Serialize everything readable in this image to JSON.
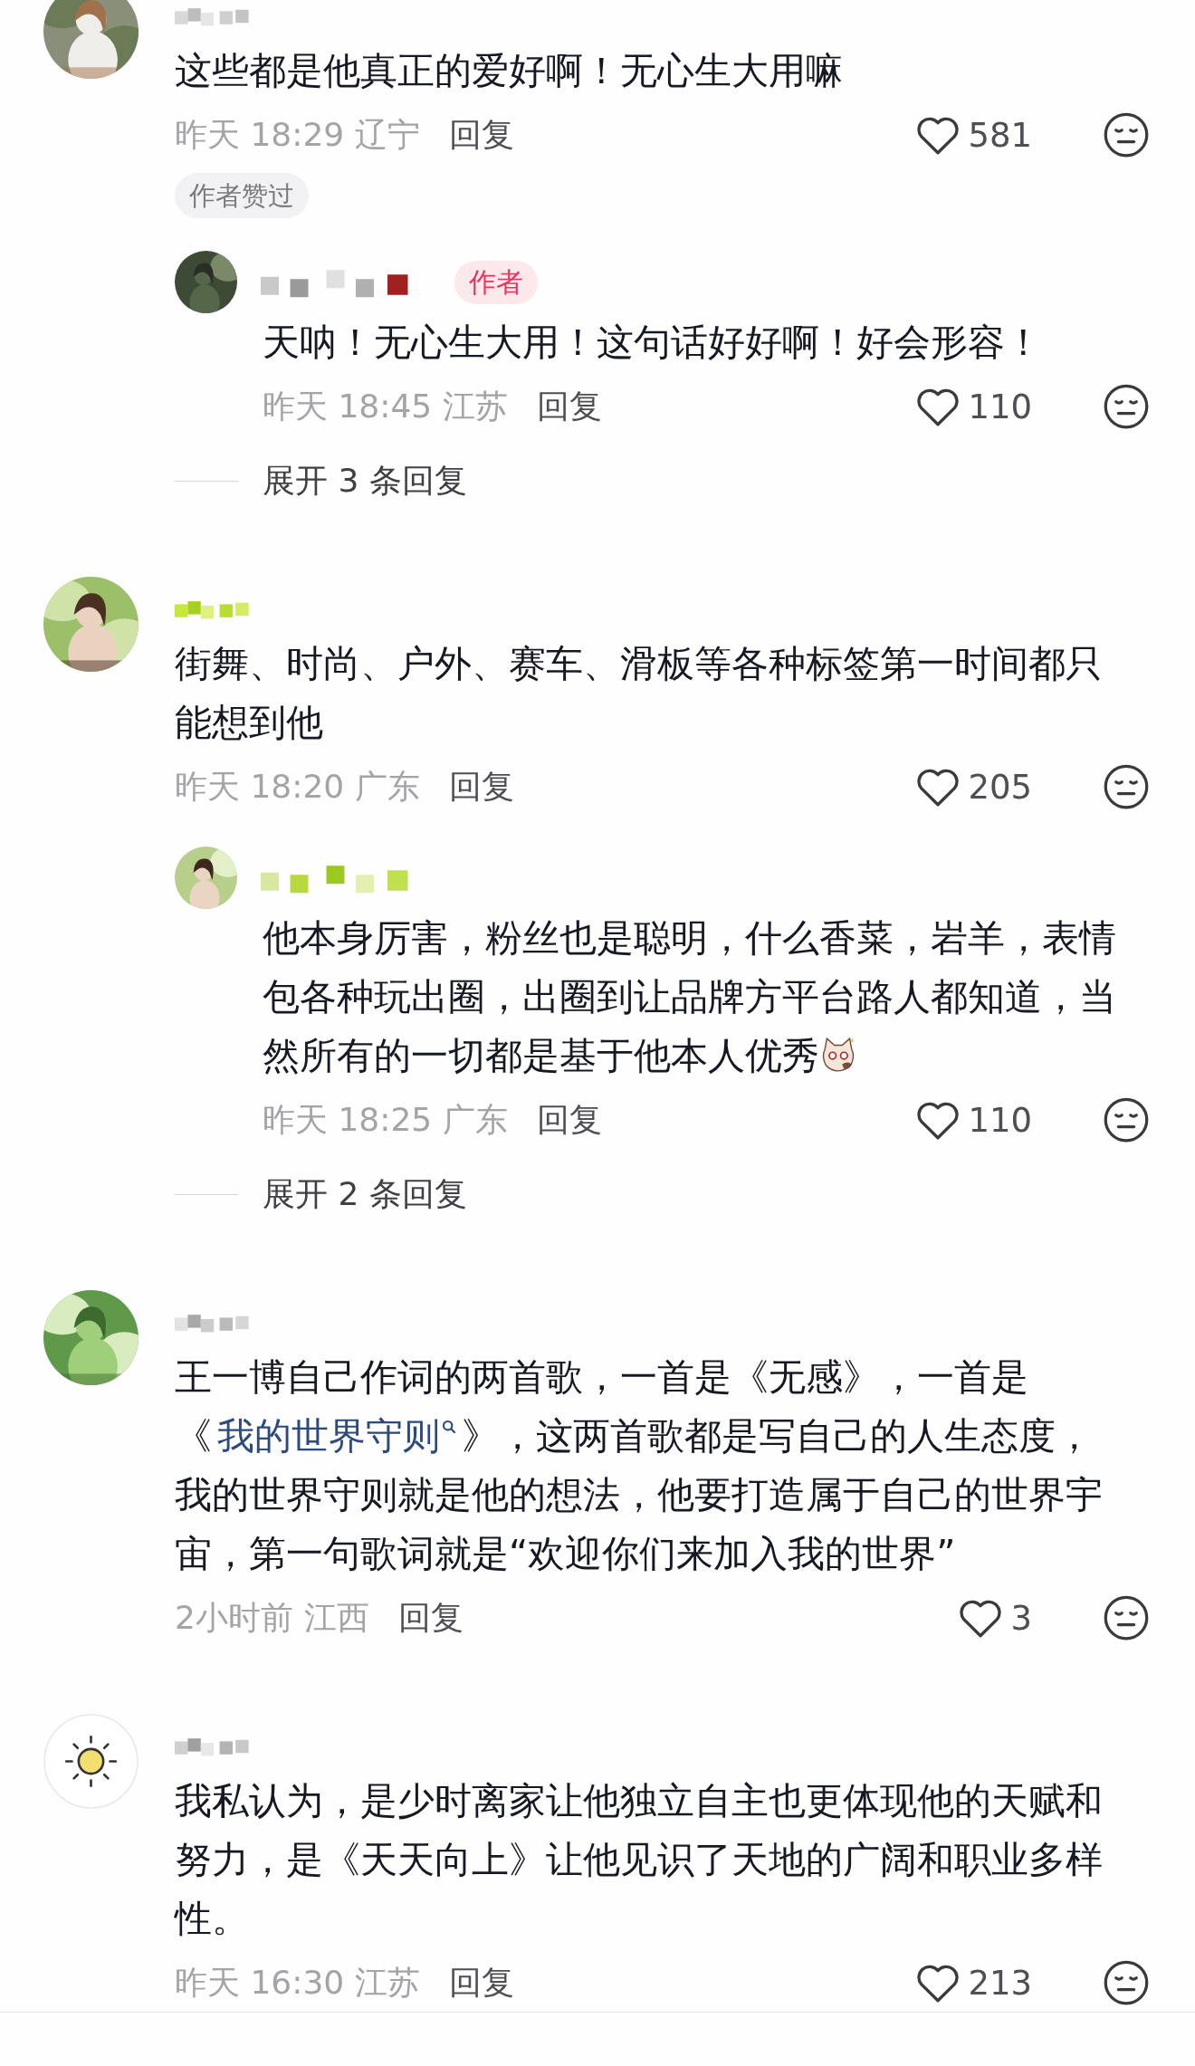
{
  "comments": [
    {
      "avatar": {
        "kind": "picture"
      },
      "body": [
        {
          "kind": "text",
          "text": "这些都是他真正的爱好啊！无心生大用嘛"
        }
      ],
      "time": "昨天 18:29",
      "location": "辽宁",
      "reply": "回复",
      "likes": "581",
      "badge": "作者赞过",
      "replies": [
        {
          "avatar": {
            "kind": "picture"
          },
          "author_tag": "作者",
          "body": [
            {
              "kind": "text",
              "text": "天呐！无心生大用！这句话好好啊！好会形容！"
            }
          ],
          "time": "昨天 18:45",
          "location": "江苏",
          "reply": "回复",
          "likes": "110"
        }
      ],
      "expand": "展开 3 条回复"
    },
    {
      "avatar": {
        "kind": "picture"
      },
      "body": [
        {
          "kind": "text",
          "text": "街舞、时尚、户外、赛车、滑板等各种标签第一时间都只能想到他"
        }
      ],
      "time": "昨天 18:20",
      "location": "广东",
      "reply": "回复",
      "likes": "205",
      "replies": [
        {
          "avatar": {
            "kind": "picture"
          },
          "body": [
            {
              "kind": "text",
              "text": "他本身厉害，粉丝也是聪明，什么香菜，岩羊，表情包各种玩出圈，出圈到让品牌方平台路人都知道，当然所有的一切都是基于他本人优秀"
            }
          ],
          "sticker": true,
          "time": "昨天 18:25",
          "location": "广东",
          "reply": "回复",
          "likes": "110"
        }
      ],
      "expand": "展开 2 条回复"
    },
    {
      "avatar": {
        "kind": "picture"
      },
      "body": [
        {
          "kind": "text",
          "text": "王一博自己作词的两首歌，一首是《无感》，一首是《"
        },
        {
          "kind": "link",
          "text": "我的世界守则"
        },
        {
          "kind": "text",
          "text": "》，这两首歌都是写自己的人生态度，我的世界守则就是他的想法，他要打造属于自己的世界宇宙，第一句歌词就是“欢迎你们来加入我的世界”"
        }
      ],
      "time": "2小时前",
      "location": "江西",
      "reply": "回复",
      "likes": "3"
    },
    {
      "avatar": {
        "kind": "sun"
      },
      "body": [
        {
          "kind": "text",
          "text": "我私认为，是少时离家让他独立自主也更体现他的天赋和努力，是《天天向上》让他见识了天地的广阔和职业多样性。"
        }
      ],
      "time": "昨天 16:30",
      "location": "江苏",
      "reply": "回复",
      "likes": "213"
    }
  ]
}
